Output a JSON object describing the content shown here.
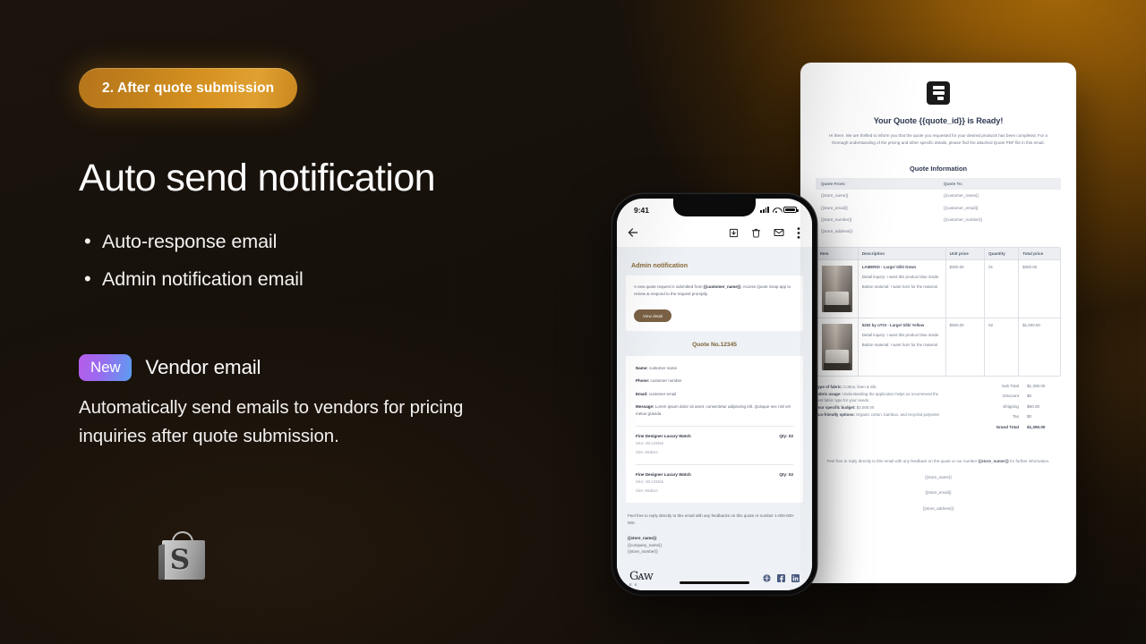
{
  "theme": {
    "background": "#140f0a",
    "accent_orange": "#d79321",
    "new_badge_gradient_from": "#b65ce8",
    "new_badge_gradient_to": "#5b9df0"
  },
  "left": {
    "step_badge": "2. After quote submission",
    "headline": "Auto send notification",
    "bullets": [
      {
        "dot": "•",
        "text": "Auto-response email"
      },
      {
        "dot": "•",
        "text": "Admin notification email"
      }
    ],
    "new_badge": "New",
    "vendor_title": "Vendor email",
    "vendor_desc": "Automatically send emails to vendors for pricing inquiries after quote submission.",
    "logo_letter": "S"
  },
  "phone": {
    "status_time": "9:41",
    "toolbar_icons": [
      "back-arrow-icon",
      "archive-icon",
      "trash-icon",
      "mail-icon",
      "overflow-menu-icon"
    ],
    "notification_title": "Admin notification",
    "notification_text_pre": "A new quote request is submitted from ",
    "notification_var": "{{customer_name}}",
    "notification_text_post": ". Access Quote Snap app to review & respond to the request promptly.",
    "view_detail_label": "View detail",
    "quote_no": "Quote No.12345",
    "fields": [
      {
        "label": "Name:",
        "value": " customer name"
      },
      {
        "label": "Phone:",
        "value": " customer number"
      },
      {
        "label": "Email:",
        "value": " customer email"
      },
      {
        "label": "Message:",
        "value": " Lorem ipsum dolor sit amet, consectetur adipiscing elit. Quisque nec nisl vel metus gravida."
      }
    ],
    "items": [
      {
        "name": "Fine Designer Luxury Watch",
        "qty": "Qty: 02",
        "sku": "SKU: AB-123456",
        "size": "Size: Medium"
      },
      {
        "name": "Fine Designer Luxury Watch",
        "qty": "Qty: 02",
        "sku": "SKU: AB-123456",
        "size": "Size: Medium"
      }
    ],
    "footnote": "Feel free to reply directly to this email with any feedbacks on this quote or number 1-000-000-000.",
    "signature": [
      "{{store_name}}",
      "{{company_name}}",
      "{{store_number}}"
    ],
    "brand_mark": "Gᴀᴡ",
    "brand_sub": "E S",
    "social": [
      "globe-icon",
      "facebook-icon",
      "linkedin-icon"
    ]
  },
  "tablet": {
    "logo": "document-logo-icon",
    "title": "Your Quote {{quote_id}} is Ready!",
    "intro": "Hi there. We are thrilled to inform you that the quote you requested for your desired products has been completed. For a thorough understanding of the pricing and other specific details, please find the attached Quote PDF file in this email.",
    "quote_info_title": "Quote Information",
    "quote_info_headers": [
      "Quote From:",
      "Quote To:"
    ],
    "quote_info_rows": [
      [
        "{{store_name}}",
        "{{customer_name}}"
      ],
      [
        "{{store_email}}",
        "{{customer_email}}"
      ],
      [
        "{{store_number}}",
        "{{customer_number}}"
      ],
      [
        "{{store_address}}",
        ""
      ]
    ],
    "items_headers": [
      "Item",
      "Description",
      "Unit price",
      "Quantity",
      "Total price"
    ],
    "items": [
      {
        "thumb": "product-image",
        "name": "LAMERDI - Large/ Silk/ Down",
        "detail_inquiry": "Detail inquiry: I want this product blue inside",
        "button_material": "Button material: I want horn for the material",
        "unit_price": "$300.00",
        "quantity": "01",
        "total_price": "$300.00"
      },
      {
        "thumb": "product-image",
        "name": "5252 by oTOI - Large/ Silk/ Yellow",
        "detail_inquiry": "Detail inquiry: I want this product blue inside",
        "button_material": "Button material: I want horn for the material",
        "unit_price": "$500.00",
        "quantity": "02",
        "total_price": "$1,000.00"
      }
    ],
    "fabric": [
      {
        "label": "Type of fabric:",
        "value": " Cotton, linen & silk."
      },
      {
        "label": "Fabric usage:",
        "value": " Understanding the application helps us recommend the best fabric type for your needs."
      },
      {
        "label": "Your specific budget:",
        "value": " $2,000.00"
      },
      {
        "label": "Eco-friendly options:",
        "value": " Organic cotton, bamboo, and recycled polyester"
      }
    ],
    "totals": [
      {
        "label": "Sub Total",
        "value": "$1,300.00"
      },
      {
        "label": "Discount",
        "value": "$0"
      },
      {
        "label": "Shipping",
        "value": "$50.00"
      },
      {
        "label": "Tax",
        "value": "$0"
      }
    ],
    "grand_total": {
      "label": "Grand Total",
      "value": "$1,350.00"
    },
    "footer_pre": "Feel free to reply directly to this email with any feedback on the quote or our number ",
    "footer_var": "{{store_numer}}",
    "footer_post": " for further information.",
    "footer_lines": [
      "{{store_name}}",
      "{{store_email}}",
      "{{store_address}}"
    ]
  }
}
